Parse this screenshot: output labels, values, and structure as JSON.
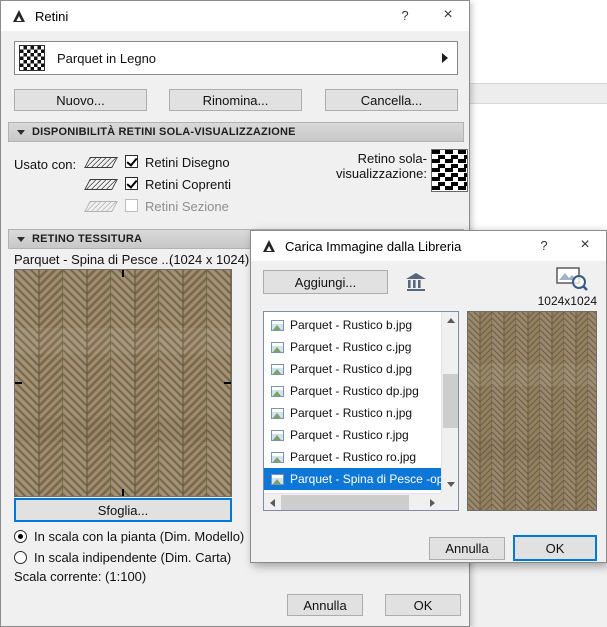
{
  "retini": {
    "title": "Retini",
    "help": "?",
    "close": "×",
    "selector": {
      "label": "Parquet in Legno"
    },
    "actions": {
      "new": "Nuovo...",
      "rename": "Rinomina...",
      "delete": "Cancella..."
    },
    "availability": {
      "header": "DISPONIBILITÀ RETINI SOLA-VISUALIZZAZIONE",
      "used_with": "Usato con:",
      "items": [
        {
          "label": "Retini Disegno",
          "checked": true
        },
        {
          "label": "Retini Coprenti",
          "checked": true
        },
        {
          "label": "Retini Sezione",
          "checked": false
        }
      ],
      "overlay_label_line1": "Retino sola-",
      "overlay_label_line2": "visualizzazione:"
    },
    "texture": {
      "header": "RETINO TESSITURA",
      "name": "Parquet - Spina di Pesce ...",
      "size": "(1024 x 1024)",
      "browse": "Sfoglia...",
      "radios": [
        {
          "label": "In scala con la pianta (Dim. Modello)",
          "selected": true
        },
        {
          "label": "In scala indipendente (Dim. Carta)",
          "selected": false
        }
      ],
      "scale": "Scala corrente: (1:100)"
    },
    "footer": {
      "cancel": "Annulla",
      "ok": "OK"
    }
  },
  "load": {
    "title": "Carica Immagine dalla Libreria",
    "help": "?",
    "close": "×",
    "add": "Aggiungi...",
    "size": "1024x1024",
    "files": [
      "Parquet - Rustico b.jpg",
      "Parquet - Rustico c.jpg",
      "Parquet - Rustico d.jpg",
      "Parquet - Rustico dp.jpg",
      "Parquet - Rustico n.jpg",
      "Parquet - Rustico r.jpg",
      "Parquet - Rustico ro.jpg",
      "Parquet - Spina di Pesce -op"
    ],
    "selected_index": 7,
    "footer": {
      "cancel": "Annulla",
      "ok": "OK"
    }
  },
  "colors": {
    "accent": "#0078d7",
    "selection": "#0d77d7",
    "texture_base": "#98876a",
    "texture_line": "#6b5c45"
  }
}
